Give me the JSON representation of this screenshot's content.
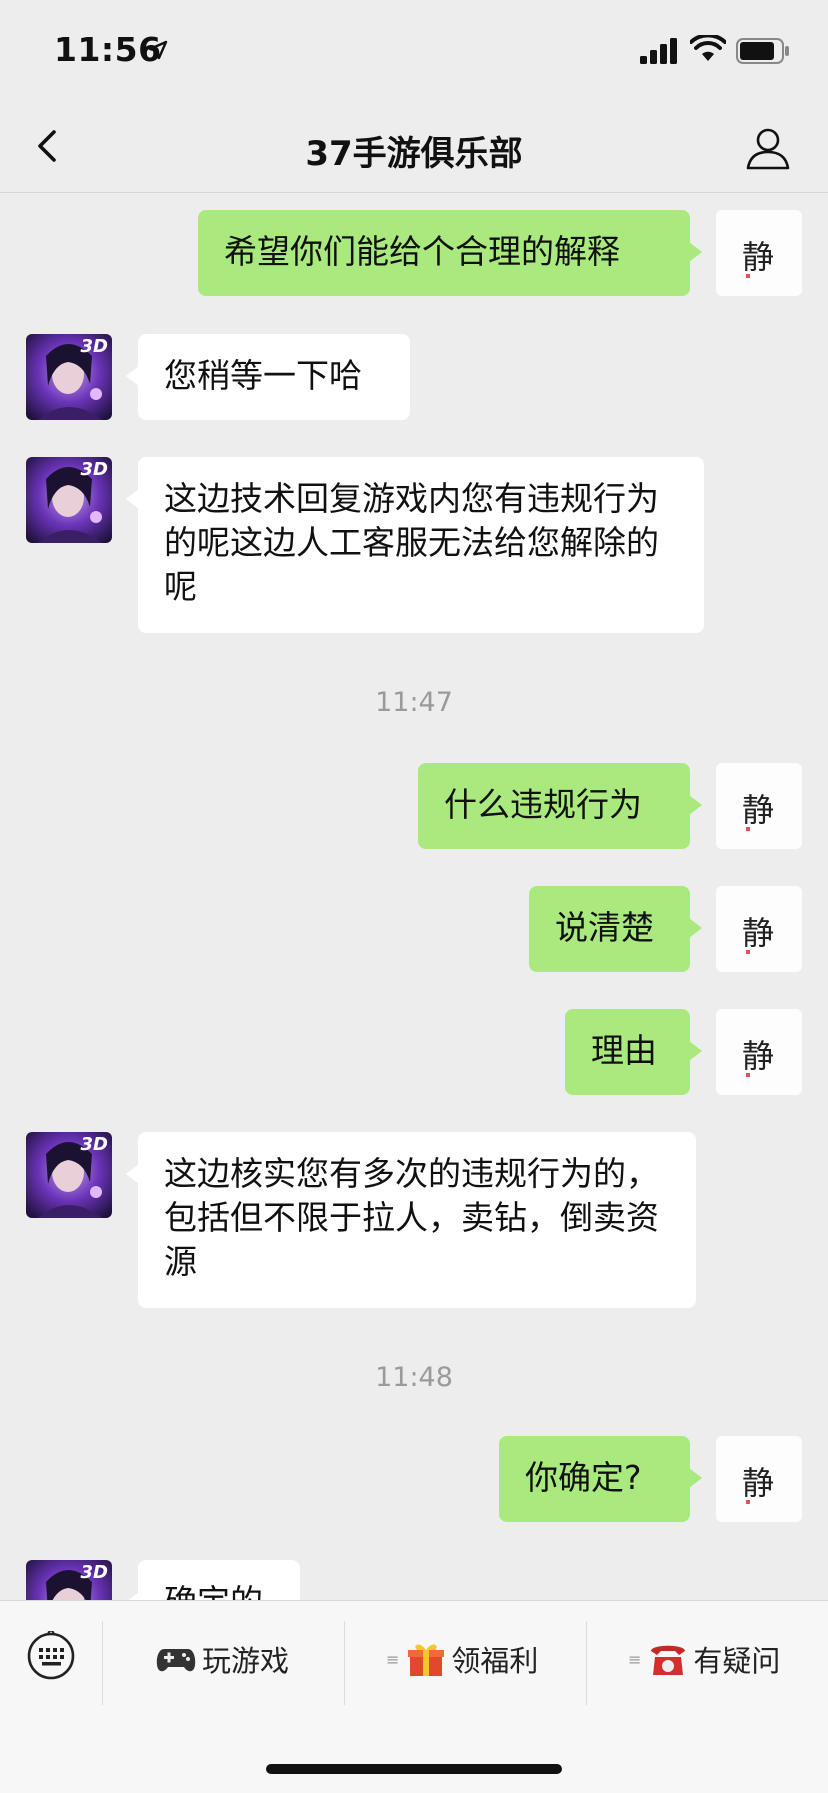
{
  "status": {
    "time": "11:56"
  },
  "header": {
    "title": "37手游俱乐部"
  },
  "messages": [
    {
      "text": "希望你们能给个合理的解释"
    },
    {
      "text": "您稍等一下哈"
    },
    {
      "text": "这边技术回复游戏内您有违规行为的呢这边人工客服无法给您解除的呢"
    },
    {
      "text": "什么违规行为"
    },
    {
      "text": "说清楚"
    },
    {
      "text": "理由"
    },
    {
      "text": "这边核实您有多次的违规行为的，包括但不限于拉人，卖钻，倒卖资源"
    },
    {
      "text": "你确定?"
    },
    {
      "text": "确定的"
    }
  ],
  "timestamps": [
    "11:47",
    "11:48"
  ],
  "avatar": {
    "me_glyph": "静",
    "bot_badge": "3D"
  },
  "menu": [
    {
      "label": "玩游戏",
      "icon": "game-controller-icon"
    },
    {
      "label": "领福利",
      "icon": "gift-icon"
    },
    {
      "label": "有疑问",
      "icon": "telephone-icon"
    }
  ],
  "colors": {
    "me_bubble": "#a9e97d",
    "other_bubble": "#ffffff",
    "background": "#ededed"
  }
}
